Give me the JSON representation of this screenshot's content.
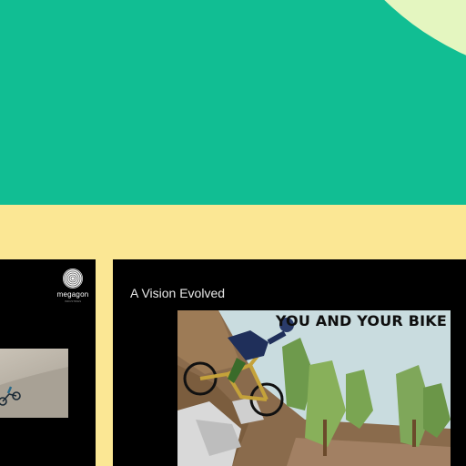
{
  "colors": {
    "hero_bg": "#11be93",
    "hero_accent": "#e4f6c0",
    "band": "#fbe794",
    "panel": "#000000"
  },
  "left_card": {
    "logo_text": "megagon",
    "logo_sub": "INDUSTRIES",
    "logo_icon": "megagon-fingerprint-logo"
  },
  "right_card": {
    "title": "A Vision Evolved",
    "art_caption": "YOU AND YOUR BIKE"
  }
}
